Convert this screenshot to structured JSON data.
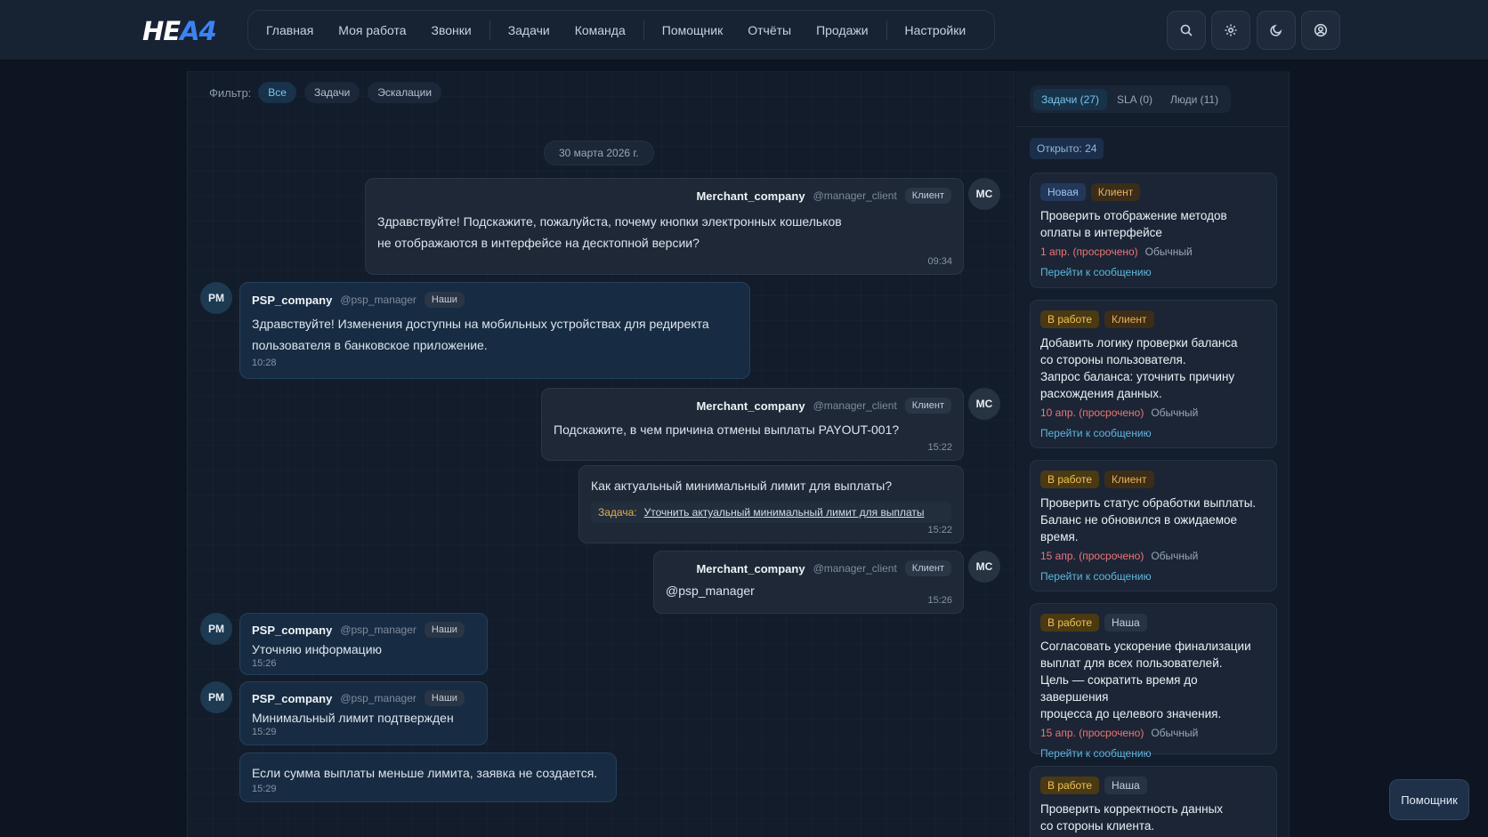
{
  "app": {
    "logo_main": "HE",
    "logo_accent": "A4"
  },
  "nav": {
    "items": [
      "Главная",
      "Моя работа",
      "Звонки",
      "Задачи",
      "Команда",
      "Помощник",
      "Отчёты",
      "Продажи",
      "Настройки"
    ]
  },
  "top_icons": [
    "search-icon",
    "gear-icon",
    "moon-icon",
    "user-icon"
  ],
  "filter": {
    "label": "Фильтр:",
    "chips": [
      "Все",
      "Задачи",
      "Эскалации"
    ],
    "active": "Все"
  },
  "chat": {
    "date": "30 марта 2026 г.",
    "messages": [
      {
        "author": "Merchant_company",
        "handle": "@manager_client",
        "badge": "Клиент",
        "avatar": "MC",
        "text1": "Здравствуйте! Подскажите, пожалуйста, почему кнопки электронных кошельков",
        "text2": "не отображаются в интерфейсе на десктопной версии?",
        "time": "09:34"
      },
      {
        "author": "PSP_company",
        "handle": "@psp_manager",
        "badge": "Наши",
        "avatar": "PM",
        "text1": "Здравствуйте! Изменения доступны на мобильных устройствах для редиректа",
        "text2": "пользователя в банковское приложение.",
        "time": "10:28"
      },
      {
        "author": "Merchant_company",
        "handle": "@manager_client",
        "badge": "Клиент",
        "avatar": "MC",
        "text1": "Подскажите, в чем причина отмены выплаты PAYOUT-001?",
        "time": "15:22"
      },
      {
        "text1": "Как актуальный минимальный лимит для выплаты?",
        "task_label": "Задача:",
        "task_link": "Уточнить актуальный минимальный лимит для выплаты",
        "time": "15:22"
      },
      {
        "author": "Merchant_company",
        "handle": "@manager_client",
        "badge": "Клиент",
        "avatar": "MC",
        "text1": "@psp_manager",
        "time": "15:26"
      },
      {
        "author": "PSP_company",
        "handle": "@psp_manager",
        "badge": "Наши",
        "avatar": "PM",
        "text1": "Уточняю информацию",
        "time": "15:26"
      },
      {
        "author": "PSP_company",
        "handle": "@psp_manager",
        "badge": "Наши",
        "avatar": "PM",
        "text1": "Минимальный лимит подтвержден",
        "time": "15:29"
      },
      {
        "text1": "Если сумма выплаты меньше лимита, заявка не создается.",
        "time": "15:29"
      }
    ]
  },
  "side": {
    "tabs": [
      "Задачи (27)",
      "SLA (0)",
      "Люди (11)"
    ],
    "open_count": "Открыто: 24",
    "link_text": "Перейти к сообщению",
    "cards": [
      {
        "status": "Новая",
        "owner": "Клиент",
        "title_lines": [
          "Проверить отображение методов",
          "оплаты в интерфейсе"
        ],
        "due": "1 апр. (просрочено)",
        "priority": "Обычный"
      },
      {
        "status": "В работе",
        "owner": "Клиент",
        "title_lines": [
          "Добавить логику проверки баланса",
          "со стороны пользователя.",
          "Запрос баланса: уточнить причину",
          "расхождения данных."
        ],
        "due": "10 апр. (просрочено)",
        "priority": "Обычный"
      },
      {
        "status": "В работе",
        "owner": "Клиент",
        "title_lines": [
          "Проверить статус обработки выплаты.",
          "Баланс не обновился в ожидаемое",
          "время."
        ],
        "due": "15 апр. (просрочено)",
        "priority": "Обычный"
      },
      {
        "status": "В работе",
        "owner": "Наша",
        "title_lines": [
          "Согласовать ускорение финализации",
          "выплат для всех пользователей.",
          "Цель — сократить время до завершения",
          "процесса до целевого значения."
        ],
        "due": "15 апр. (просрочено)",
        "priority": "Обычный"
      },
      {
        "status": "В работе",
        "owner": "Наша",
        "title_lines": [
          "Проверить корректность данных",
          "со стороны клиента."
        ]
      }
    ]
  },
  "assistant_button": "Помощник"
}
